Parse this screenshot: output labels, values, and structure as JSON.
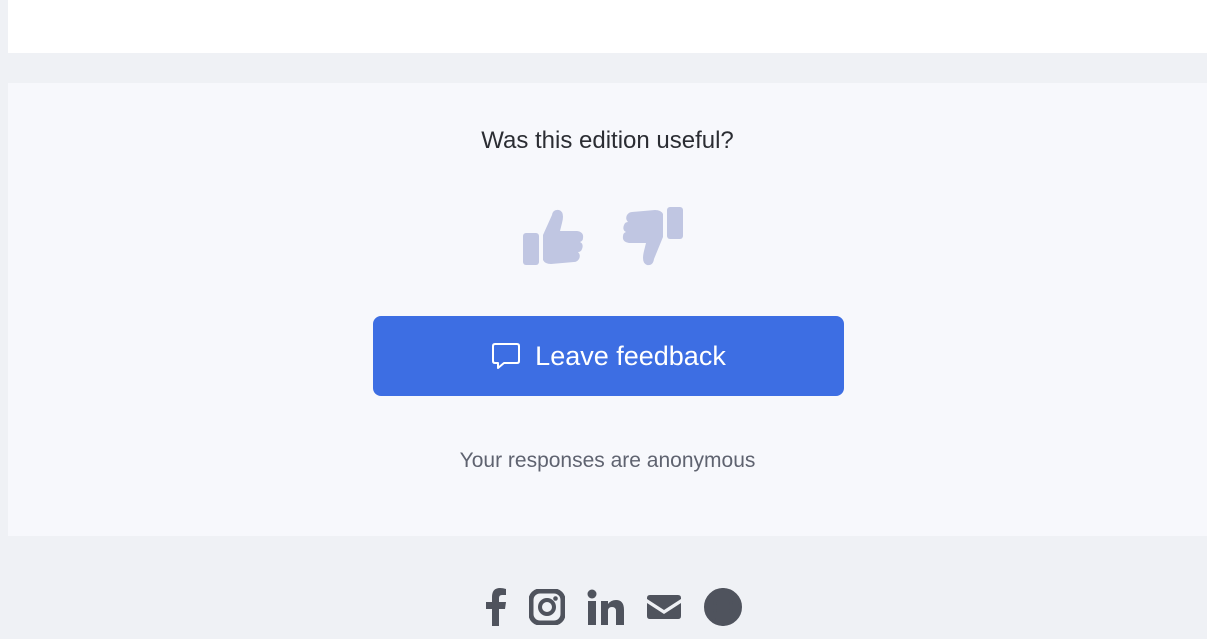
{
  "feedback": {
    "question": "Was this edition useful?",
    "leave_button_label": "Leave feedback",
    "anonymous_note": "Your responses are anonymous",
    "vote_icons": [
      "thumbs-up-icon",
      "thumbs-down-icon"
    ],
    "button_icon": "chat-bubble-icon"
  },
  "footer": {
    "social_icons": [
      "facebook-icon",
      "instagram-icon",
      "linkedin-icon",
      "email-icon",
      "globe-icon"
    ]
  },
  "colors": {
    "page_background": "#eff1f5",
    "panel_background": "#f7f8fc",
    "primary_button": "#3d6ee3",
    "vote_icon": "#c0c6e2",
    "social_icon": "#4f535d",
    "question_text": "#2b2d33",
    "muted_text": "#5f6370"
  }
}
